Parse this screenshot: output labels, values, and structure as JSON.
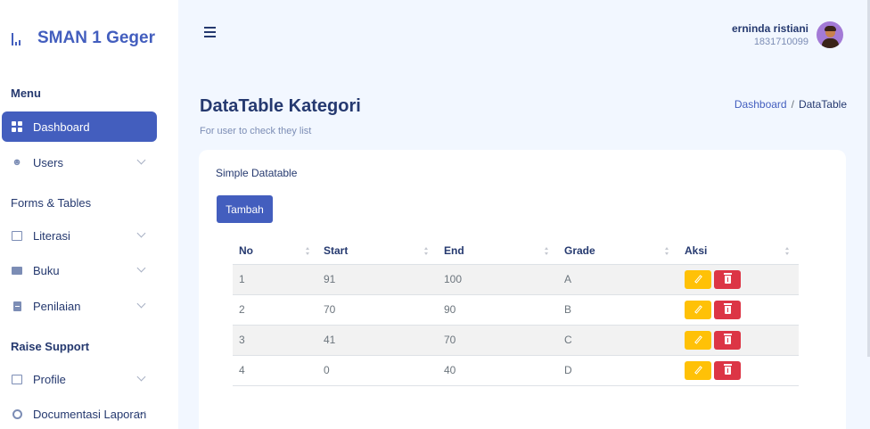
{
  "brand": {
    "name": "SMAN 1 Geger"
  },
  "sidebar": {
    "sections": [
      "Menu",
      "Forms & Tables",
      "Raise Support"
    ],
    "items": [
      {
        "label": "Dashboard",
        "icon": "grid-icon"
      },
      {
        "label": "Users",
        "icon": "users-icon"
      },
      {
        "label": "Literasi",
        "icon": "image-icon"
      },
      {
        "label": "Buku",
        "icon": "book-icon"
      },
      {
        "label": "Penilaian",
        "icon": "document-icon"
      },
      {
        "label": "Profile",
        "icon": "profile-icon"
      },
      {
        "label": "Documentasi Laporan",
        "icon": "gear-icon"
      }
    ]
  },
  "header": {
    "user_name": "erninda ristiani",
    "user_id": "1831710099"
  },
  "page": {
    "title": "DataTable Kategori",
    "subtitle": "For user to check they list",
    "breadcrumb": {
      "home": "Dashboard",
      "separator": "/",
      "current": "DataTable"
    }
  },
  "card": {
    "title": "Simple Datatable",
    "add_label": "Tambah"
  },
  "table": {
    "columns": [
      "No",
      "Start",
      "End",
      "Grade",
      "Aksi"
    ],
    "rows": [
      {
        "no": "1",
        "start": "91",
        "end": "100",
        "grade": "A"
      },
      {
        "no": "2",
        "start": "70",
        "end": "90",
        "grade": "B"
      },
      {
        "no": "3",
        "start": "41",
        "end": "70",
        "grade": "C"
      },
      {
        "no": "4",
        "start": "0",
        "end": "40",
        "grade": "D"
      }
    ]
  },
  "colors": {
    "primary": "#435ebe",
    "edit": "#ffc107",
    "delete": "#dc3545",
    "background": "#f2f7ff"
  }
}
